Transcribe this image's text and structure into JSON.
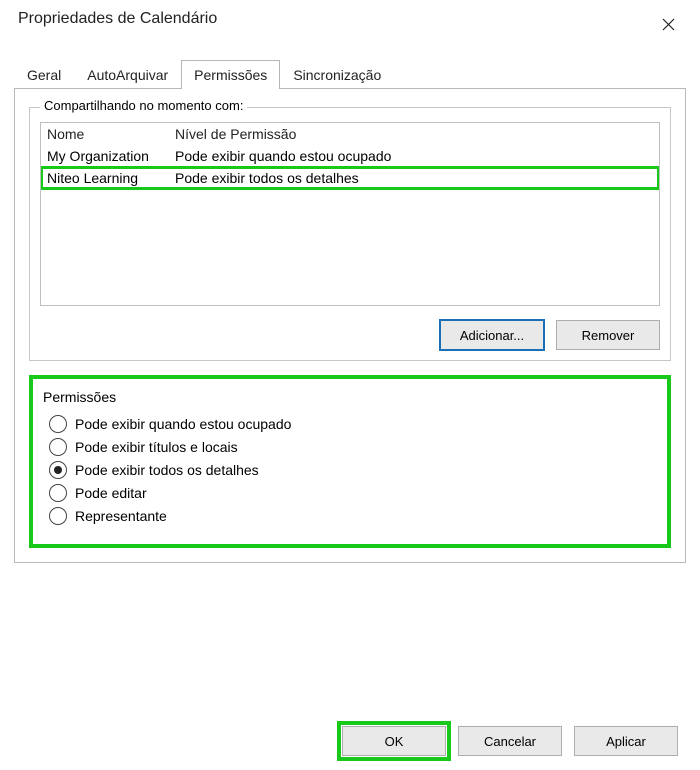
{
  "window": {
    "title": "Propriedades de Calendário"
  },
  "tabs": {
    "items": [
      {
        "label": "Geral"
      },
      {
        "label": "AutoArquivar"
      },
      {
        "label": "Permissões"
      },
      {
        "label": "Sincronização"
      }
    ],
    "activeIndex": 2
  },
  "sharingGroup": {
    "legend": "Compartilhando no momento com:",
    "headers": {
      "name": "Nome",
      "permission": "Nível de Permissão"
    },
    "rows": [
      {
        "name": "My Organization",
        "permission": "Pode exibir quando estou ocupado"
      },
      {
        "name": "Niteo Learning",
        "permission": "Pode exibir todos os detalhes"
      }
    ],
    "highlightIndex": 1,
    "buttons": {
      "add": "Adicionar...",
      "remove": "Remover"
    }
  },
  "permissions": {
    "title": "Permissões",
    "options": [
      "Pode exibir quando estou ocupado",
      "Pode exibir títulos e locais",
      "Pode exibir todos os detalhes",
      "Pode editar",
      "Representante"
    ],
    "selectedIndex": 2
  },
  "footer": {
    "ok": "OK",
    "cancel": "Cancelar",
    "apply": "Aplicar"
  }
}
